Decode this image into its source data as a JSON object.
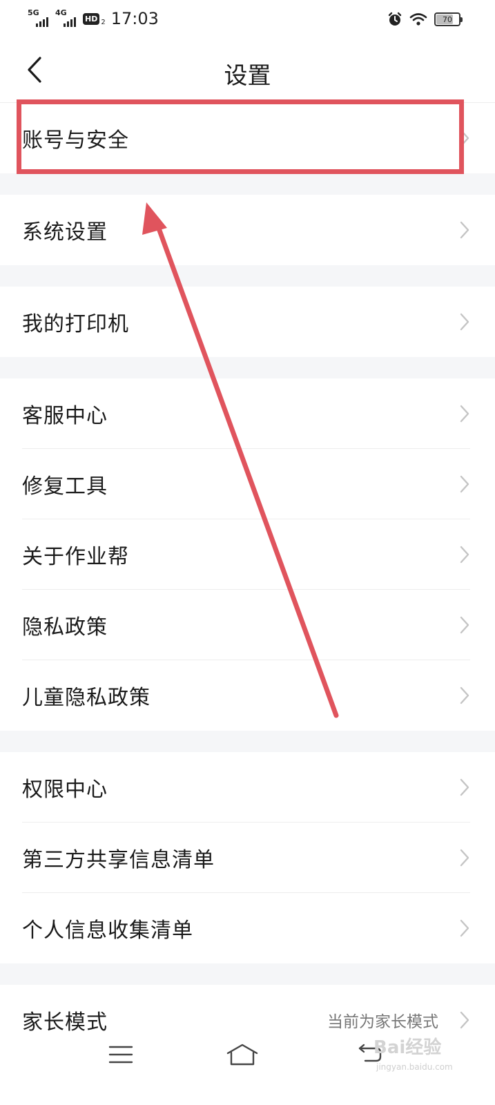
{
  "status_bar": {
    "network_1": "5G",
    "network_2": "4G",
    "hd_badge": "HD",
    "hd_sub": "2",
    "time": "17:03",
    "battery_level": 70,
    "battery_label": "70"
  },
  "nav": {
    "title": "设置"
  },
  "sections": [
    {
      "items": [
        {
          "label": "账号与安全",
          "highlighted": true
        }
      ]
    },
    {
      "items": [
        {
          "label": "系统设置"
        }
      ]
    },
    {
      "items": [
        {
          "label": "我的打印机"
        }
      ]
    },
    {
      "items": [
        {
          "label": "客服中心"
        },
        {
          "label": "修复工具"
        },
        {
          "label": "关于作业帮"
        },
        {
          "label": "隐私政策"
        },
        {
          "label": "儿童隐私政策"
        }
      ]
    },
    {
      "items": [
        {
          "label": "权限中心"
        },
        {
          "label": "第三方共享信息清单"
        },
        {
          "label": "个人信息收集清单"
        }
      ]
    },
    {
      "items": [
        {
          "label": "家长模式",
          "value": "当前为家长模式"
        }
      ]
    }
  ],
  "watermark": {
    "text": "Bai经验",
    "sub": "jingyan.baidu.com"
  },
  "colors": {
    "annotation": "#e0545d",
    "section_gap": "#f5f6f8",
    "chevron": "#c4c4c4"
  }
}
